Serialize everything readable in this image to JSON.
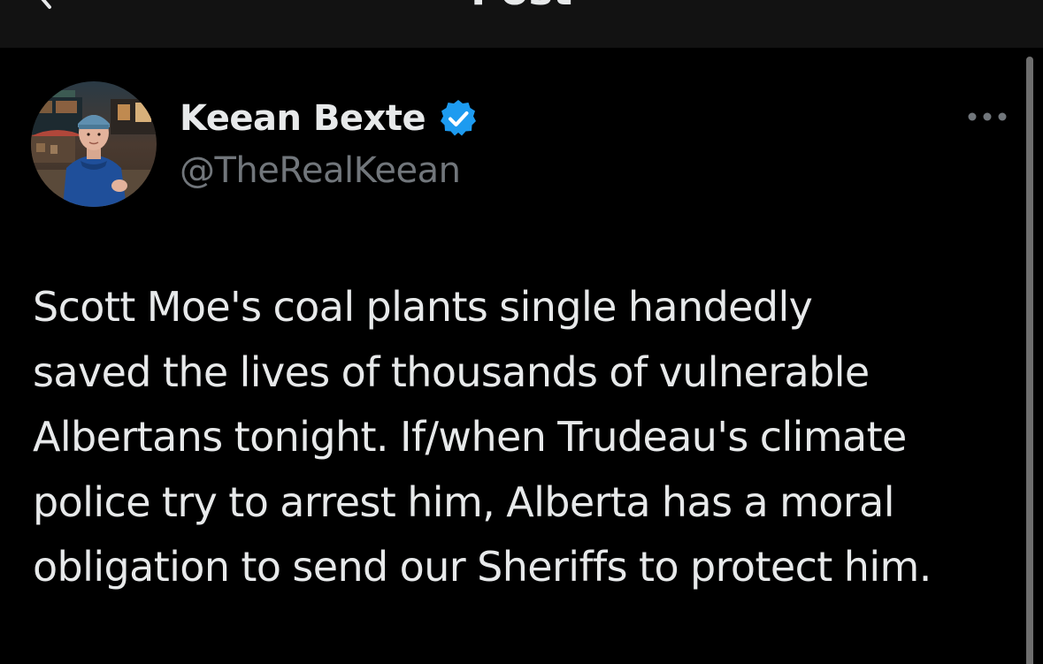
{
  "header": {
    "title": "Post",
    "back_icon": "chevron-left-icon"
  },
  "author": {
    "name": "Keean Bexte",
    "handle": "@TheRealKeean",
    "verified_icon": "verified-badge-icon",
    "verified_color": "#1d9bf0",
    "more_icon": "more-horizontal-icon"
  },
  "tweet": {
    "lines": [
      "Scott Moe's coal plants single handedly",
      "saved the lives of thousands of vulnerable",
      "Albertans tonight. If/when Trudeau's climate",
      "police try to arrest him, Alberta has a moral",
      "obligation to send our Sheriffs to protect him."
    ]
  },
  "colors": {
    "background": "#000000",
    "topbar": "#121212",
    "text_primary": "#e7e9ea",
    "text_secondary": "#71767b",
    "accent": "#1d9bf0"
  }
}
